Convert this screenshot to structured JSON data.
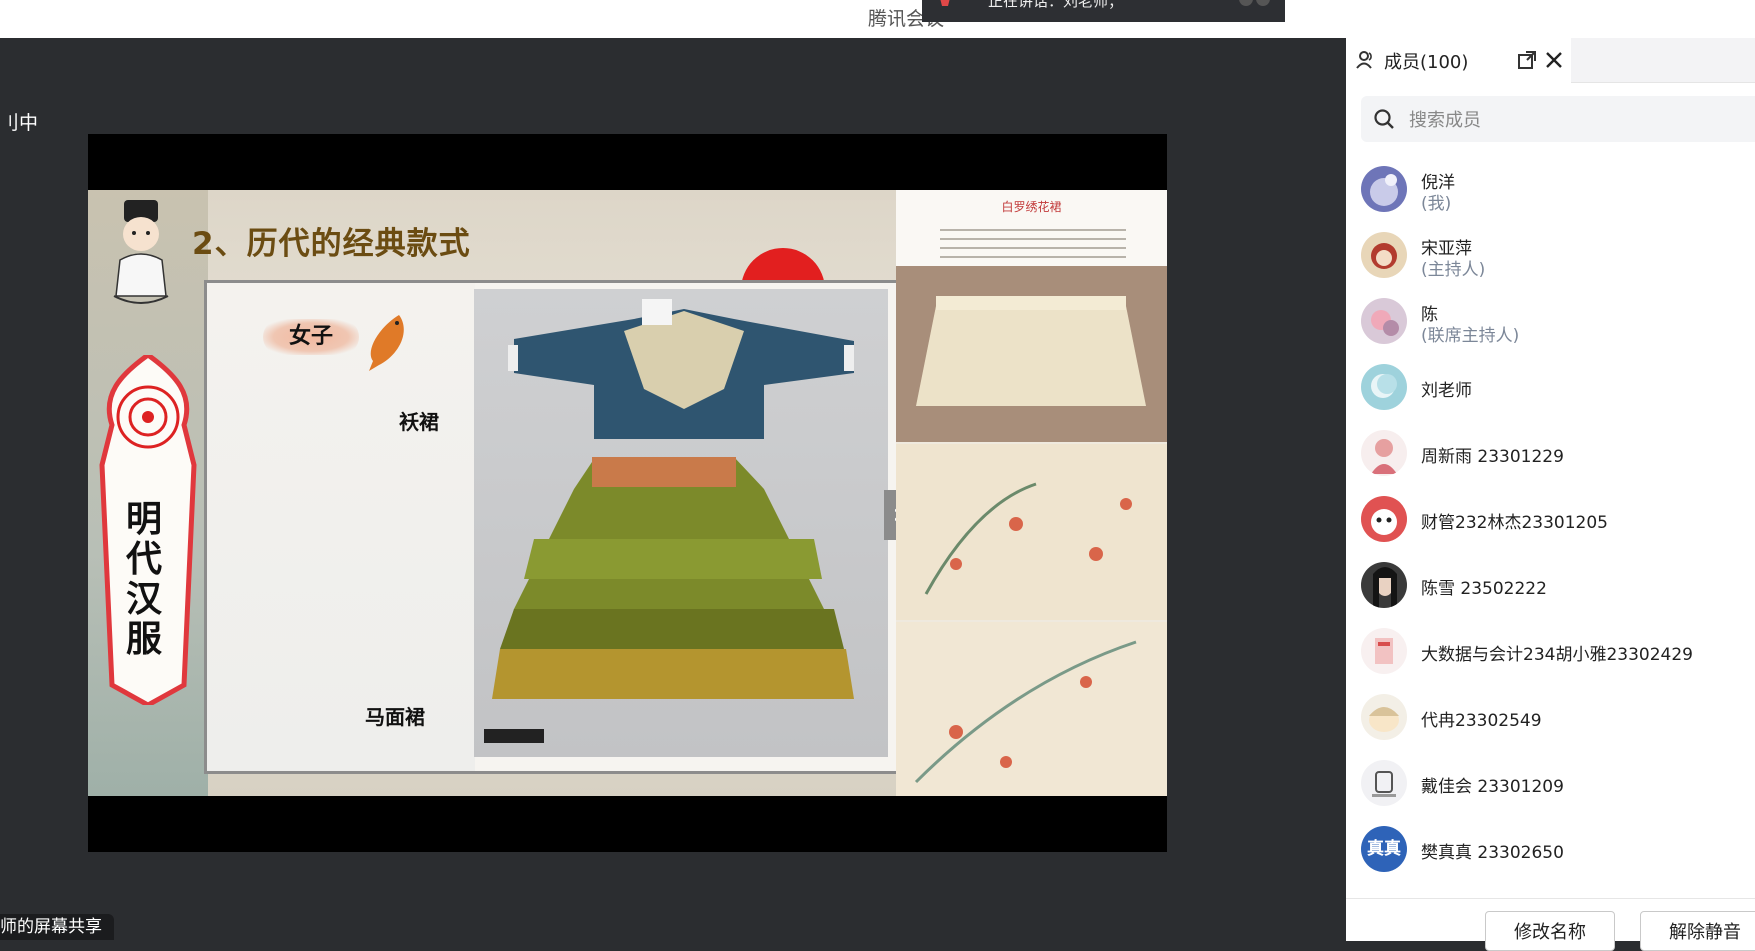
{
  "window": {
    "app_title": "腾讯会议",
    "speaking_text": "正在讲话：刘老师；"
  },
  "stage": {
    "left_status_fragment": "刂中",
    "share_label": "师的屏幕共享"
  },
  "slide": {
    "title": "2、历代的经典款式",
    "banner_text": "明代汉服",
    "tag_women": "女子",
    "label_top": "袄裙",
    "label_bottom": "马面裙",
    "right_caption": "白罗绣花裙"
  },
  "panel": {
    "title": "成员(100)",
    "search_placeholder": "搜索成员",
    "members": [
      {
        "name": "倪洋",
        "role": "(我)"
      },
      {
        "name": "宋亚萍",
        "role": "(主持人)"
      },
      {
        "name": "陈",
        "role": "(联席主持人)"
      },
      {
        "name": "刘老师",
        "role": ""
      },
      {
        "name": " 周新雨 23301229",
        "role": ""
      },
      {
        "name": "财管232林杰23301205",
        "role": ""
      },
      {
        "name": "陈雪 23502222",
        "role": ""
      },
      {
        "name": "大数据与会计234胡小雅23302429",
        "role": ""
      },
      {
        "name": "代冉23302549",
        "role": ""
      },
      {
        "name": "戴佳会 23301209",
        "role": ""
      },
      {
        "name": "樊真真  23302650",
        "role": "",
        "avatar_text": "真真"
      }
    ],
    "buttons": {
      "rename": "修改名称",
      "unmute": "解除静音"
    }
  },
  "colors": {
    "stage_bg": "#2b2d30",
    "accent_blue": "#2e63b8",
    "role_gray": "#7c8798"
  }
}
